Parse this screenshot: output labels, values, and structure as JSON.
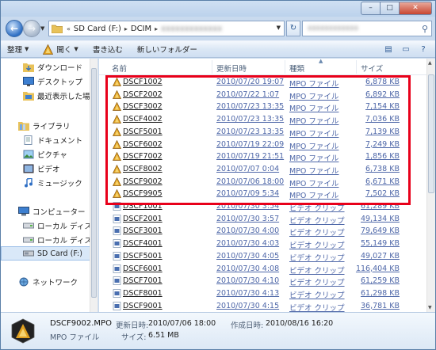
{
  "window": {
    "minimize": "–",
    "maximize": "□",
    "close": "✕"
  },
  "address": {
    "chevron": "«",
    "crumbs": [
      "SD Card (F:)",
      "DCIM",
      "xxxxxxxxxxxxx"
    ],
    "search_placeholder": "xxxxxxxxxxxx"
  },
  "toolbar": {
    "organize": "整理",
    "open": "開く",
    "burn": "書き込む",
    "new_folder": "新しいフォルダー"
  },
  "nav": {
    "items": [
      {
        "label": "ダウンロード",
        "icon": "download-folder-icon"
      },
      {
        "label": "デスクトップ",
        "icon": "desktop-icon"
      },
      {
        "label": "最近表示した場所",
        "icon": "recent-places-icon"
      },
      {
        "label": "ライブラリ",
        "icon": "library-icon"
      },
      {
        "label": "ドキュメント",
        "icon": "documents-icon"
      },
      {
        "label": "ピクチャ",
        "icon": "pictures-icon"
      },
      {
        "label": "ビデオ",
        "icon": "videos-icon"
      },
      {
        "label": "ミュージック",
        "icon": "music-icon"
      },
      {
        "label": "コンピューター",
        "icon": "computer-icon"
      },
      {
        "label": "ローカル ディスク",
        "icon": "local-disk-icon"
      },
      {
        "label": "ローカル ディスク",
        "icon": "local-disk-icon"
      },
      {
        "label": "SD Card (F:)",
        "icon": "sd-card-icon"
      },
      {
        "label": "ネットワーク",
        "icon": "network-icon"
      }
    ]
  },
  "columns": {
    "name": "名前",
    "date": "更新日時",
    "type": "種類",
    "size": "サイズ"
  },
  "files": [
    {
      "name": "DSCF1002",
      "date": "2010/07/20 19:07",
      "type": "MPO ファイル",
      "size": "6,878 KB",
      "kind": "mpo"
    },
    {
      "name": "DSCF2002",
      "date": "2010/07/22 1:07",
      "type": "MPO ファイル",
      "size": "6,892 KB",
      "kind": "mpo"
    },
    {
      "name": "DSCF3002",
      "date": "2010/07/23 13:35",
      "type": "MPO ファイル",
      "size": "7,154 KB",
      "kind": "mpo"
    },
    {
      "name": "DSCF4002",
      "date": "2010/07/23 13:35",
      "type": "MPO ファイル",
      "size": "7,036 KB",
      "kind": "mpo"
    },
    {
      "name": "DSCF5001",
      "date": "2010/07/23 13:35",
      "type": "MPO ファイル",
      "size": "7,139 KB",
      "kind": "mpo"
    },
    {
      "name": "DSCF6002",
      "date": "2010/07/19 22:09",
      "type": "MPO ファイル",
      "size": "7,249 KB",
      "kind": "mpo"
    },
    {
      "name": "DSCF7002",
      "date": "2010/07/19 21:51",
      "type": "MPO ファイル",
      "size": "1,856 KB",
      "kind": "mpo"
    },
    {
      "name": "DSCF8002",
      "date": "2010/07/07 0:04",
      "type": "MPO ファイル",
      "size": "6,738 KB",
      "kind": "mpo"
    },
    {
      "name": "DSCF9002",
      "date": "2010/07/06 18:00",
      "type": "MPO ファイル",
      "size": "6,671 KB",
      "kind": "mpo"
    },
    {
      "name": "DSCF9905",
      "date": "2010/07/09 5:34",
      "type": "MPO ファイル",
      "size": "7,502 KB",
      "kind": "mpo"
    },
    {
      "name": "DSCF1001",
      "date": "2010/07/30 3:54",
      "type": "ビデオ クリップ",
      "size": "61,289 KB",
      "kind": "avi"
    },
    {
      "name": "DSCF2001",
      "date": "2010/07/30 3:57",
      "type": "ビデオ クリップ",
      "size": "49,134 KB",
      "kind": "avi"
    },
    {
      "name": "DSCF3001",
      "date": "2010/07/30 4:00",
      "type": "ビデオ クリップ",
      "size": "79,649 KB",
      "kind": "avi"
    },
    {
      "name": "DSCF4001",
      "date": "2010/07/30 4:03",
      "type": "ビデオ クリップ",
      "size": "55,149 KB",
      "kind": "avi"
    },
    {
      "name": "DSCF5001",
      "date": "2010/07/30 4:05",
      "type": "ビデオ クリップ",
      "size": "49,027 KB",
      "kind": "avi"
    },
    {
      "name": "DSCF6001",
      "date": "2010/07/30 4:08",
      "type": "ビデオ クリップ",
      "size": "116,404 KB",
      "kind": "avi"
    },
    {
      "name": "DSCF7001",
      "date": "2010/07/30 4:10",
      "type": "ビデオ クリップ",
      "size": "61,259 KB",
      "kind": "avi"
    },
    {
      "name": "DSCF8001",
      "date": "2010/07/30 4:13",
      "type": "ビデオ クリップ",
      "size": "61,298 KB",
      "kind": "avi"
    },
    {
      "name": "DSCF9001",
      "date": "2010/07/30 4:15",
      "type": "ビデオ クリップ",
      "size": "36,781 KB",
      "kind": "avi"
    }
  ],
  "details": {
    "filename": "DSCF9002.MPO",
    "modified_label": "更新日時:",
    "modified_value": "2010/07/06 18:00",
    "created_label": "作成日時:",
    "created_value": "2010/08/16 16:20",
    "type_value": "MPO ファイル",
    "size_label": "サイズ:",
    "size_value": "6.51 MB"
  },
  "colors": {
    "highlight_box": "#e8001a",
    "link_blue": "#4e67a8",
    "mpo_icon": "#e0a020"
  }
}
